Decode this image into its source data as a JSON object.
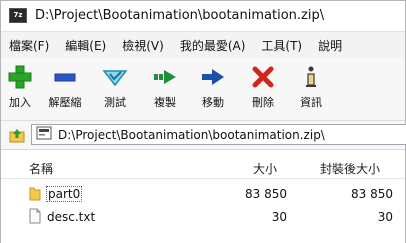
{
  "window": {
    "title": "D:\\Project\\Bootanimation\\bootanimation.zip\\",
    "app_icon_text": "7z"
  },
  "menu": [
    {
      "label": "檔案(F)"
    },
    {
      "label": "編輯(E)"
    },
    {
      "label": "檢視(V)"
    },
    {
      "label": "我的最愛(A)"
    },
    {
      "label": "工具(T)"
    },
    {
      "label": "說明"
    }
  ],
  "toolbar": [
    {
      "label": "加入",
      "icon": "add-icon",
      "color": "#2aa52a"
    },
    {
      "label": "解壓縮",
      "icon": "extract-icon",
      "color": "#2a57c8"
    },
    {
      "label": "測試",
      "icon": "test-icon",
      "color": "#1a8fb5"
    },
    {
      "label": "複製",
      "icon": "copy-icon",
      "color": "#1f8f3a"
    },
    {
      "label": "移動",
      "icon": "move-icon",
      "color": "#1a4fb0"
    },
    {
      "label": "刪除",
      "icon": "delete-icon",
      "color": "#d0261a"
    },
    {
      "label": "資訊",
      "icon": "info-icon",
      "color": "#3a3a3a"
    }
  ],
  "address": {
    "path": "D:\\Project\\Bootanimation\\bootanimation.zip\\"
  },
  "columns": {
    "name": "名稱",
    "size": "大小",
    "packed": "封裝後大小"
  },
  "rows": [
    {
      "name": "part0",
      "size": "83 850",
      "packed": "83 850",
      "type": "folder"
    },
    {
      "name": "desc.txt",
      "size": "30",
      "packed": "30",
      "type": "file"
    }
  ]
}
